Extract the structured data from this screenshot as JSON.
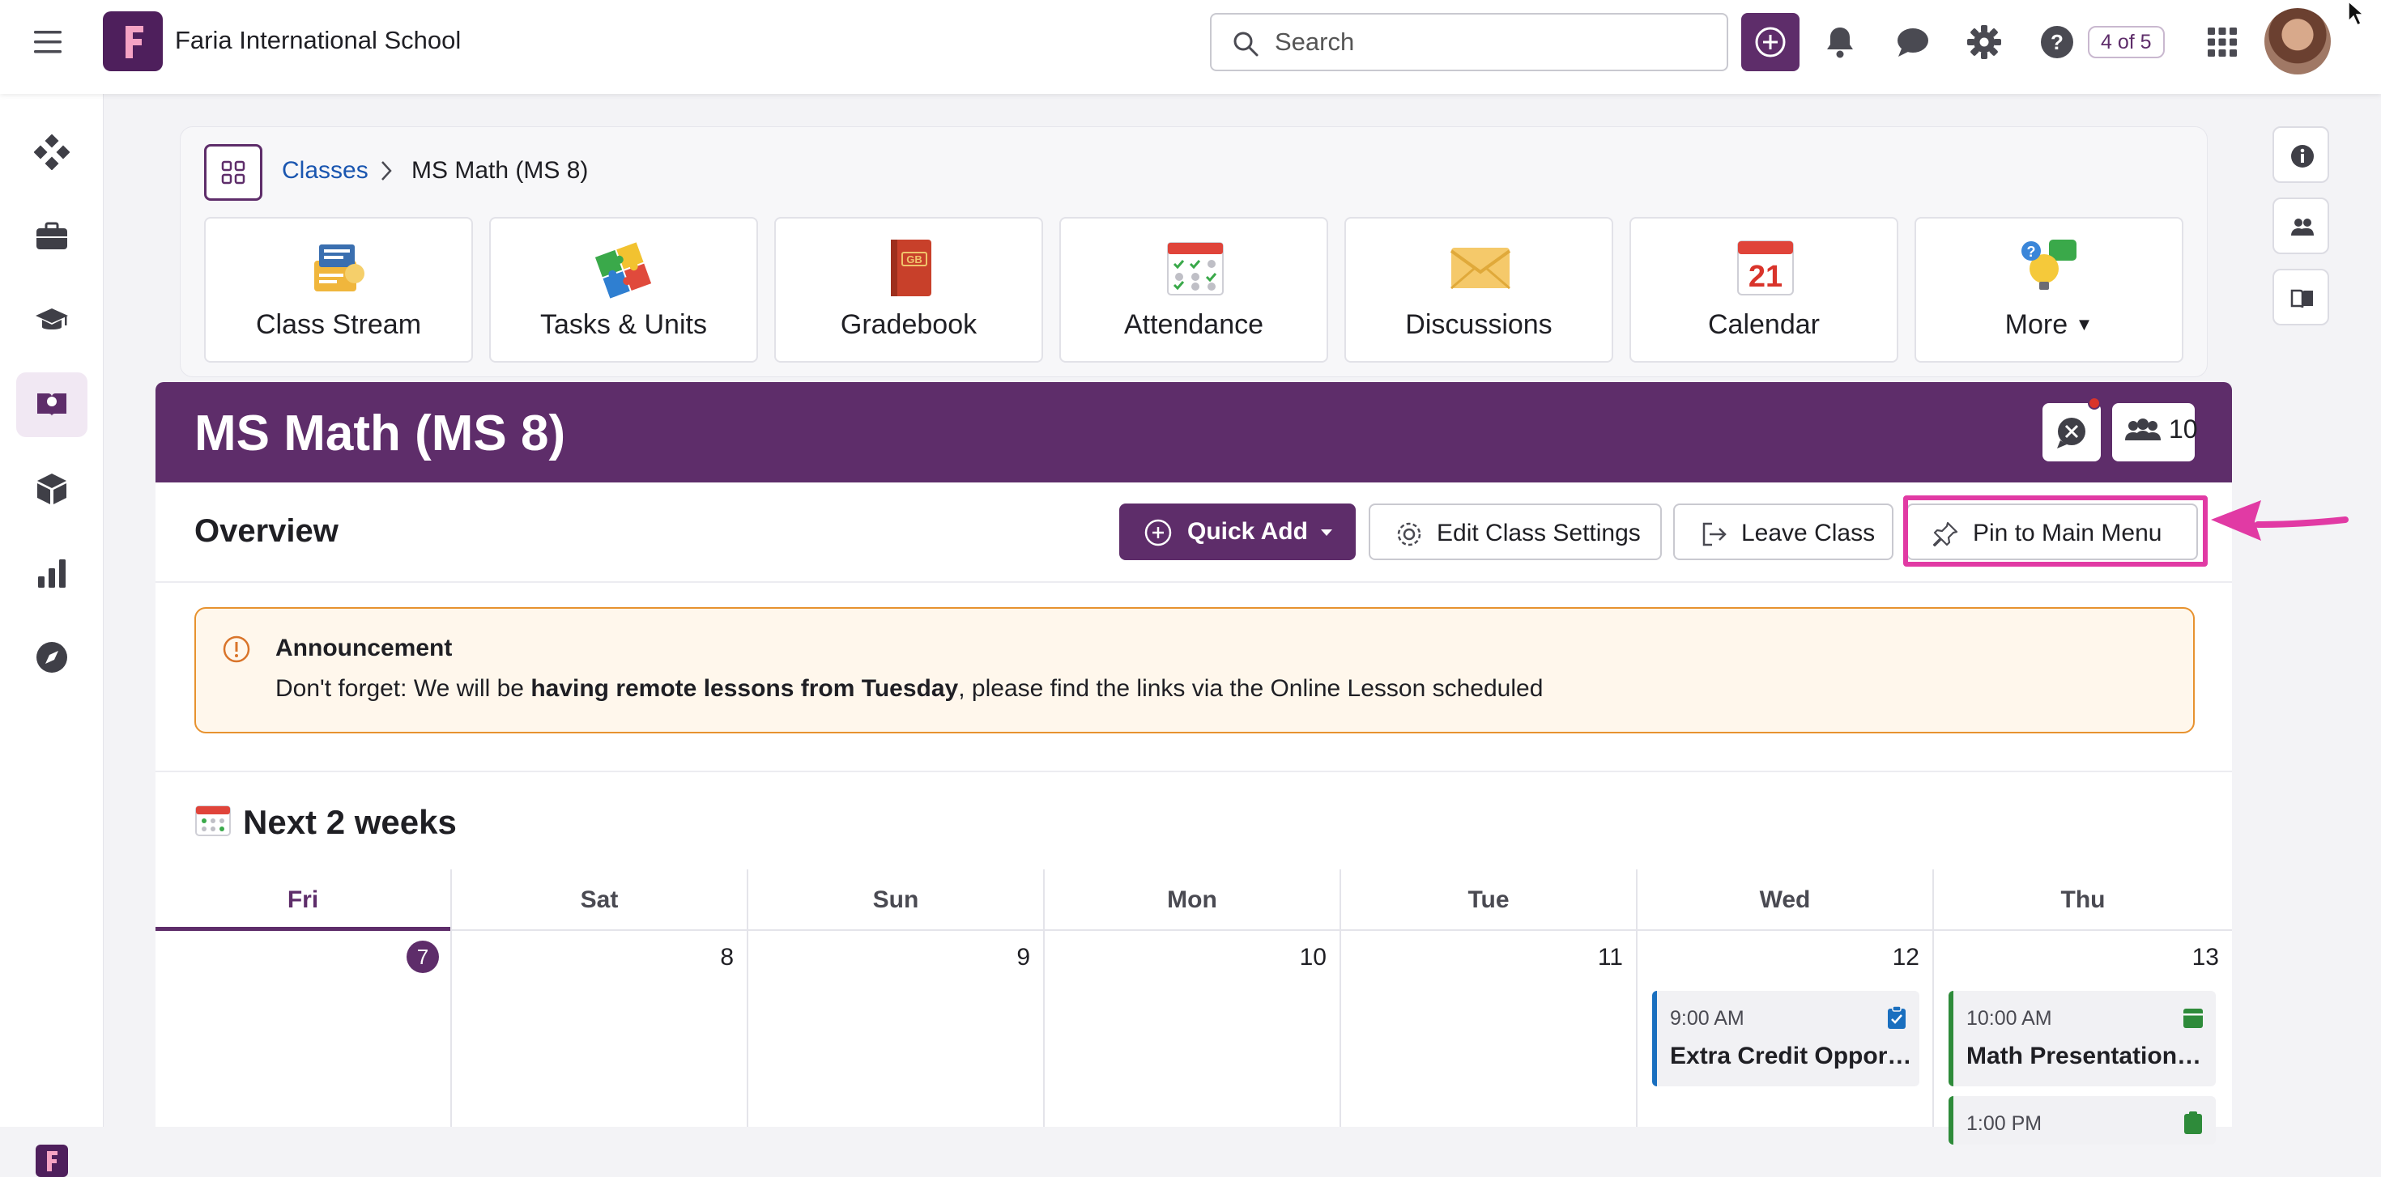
{
  "topbar": {
    "school_name": "Faria International School",
    "search_placeholder": "Search",
    "counter": "4 of 5"
  },
  "breadcrumb": {
    "link": "Classes",
    "current": "MS Math (MS 8)"
  },
  "tiles": [
    {
      "label": "Class Stream",
      "icon": "class-stream-icon"
    },
    {
      "label": "Tasks & Units",
      "icon": "puzzle-icon"
    },
    {
      "label": "Gradebook",
      "icon": "gradebook-icon"
    },
    {
      "label": "Attendance",
      "icon": "attendance-icon"
    },
    {
      "label": "Discussions",
      "icon": "envelope-icon"
    },
    {
      "label": "Calendar",
      "icon": "calendar-icon"
    },
    {
      "label": "More",
      "icon": "more-icon"
    }
  ],
  "calendar_tile_day": "21",
  "gradebook_tile_text": "GB",
  "class": {
    "title": "MS Math (MS 8)",
    "member_count": "10"
  },
  "overview": {
    "title": "Overview",
    "quick_add": "Quick Add",
    "edit_settings": "Edit Class Settings",
    "leave_class": "Leave Class",
    "pin": "Pin to Main Menu"
  },
  "announcement": {
    "title": "Announcement",
    "prefix": "Don't forget: We will be ",
    "bold": "having remote lessons from Tuesday",
    "suffix": ", please find the links via the Online Lesson scheduled"
  },
  "next_weeks": {
    "title": "Next 2 weeks",
    "days": [
      {
        "name": "Fri",
        "date": "7",
        "today": true
      },
      {
        "name": "Sat",
        "date": "8"
      },
      {
        "name": "Sun",
        "date": "9"
      },
      {
        "name": "Mon",
        "date": "10"
      },
      {
        "name": "Tue",
        "date": "11"
      },
      {
        "name": "Wed",
        "date": "12"
      },
      {
        "name": "Thu",
        "date": "13"
      }
    ],
    "events": {
      "wed": {
        "time": "9:00 AM",
        "name": "Extra Credit Opport..."
      },
      "thu": {
        "time": "10:00 AM",
        "name": "Math Presentation: ..."
      },
      "thu2": {
        "time": "1:00 PM"
      }
    }
  },
  "colors": {
    "brand": "#5e2d6a",
    "highlight": "#e13aa4",
    "announce_border": "#e7922f",
    "link": "#1a56b0"
  }
}
